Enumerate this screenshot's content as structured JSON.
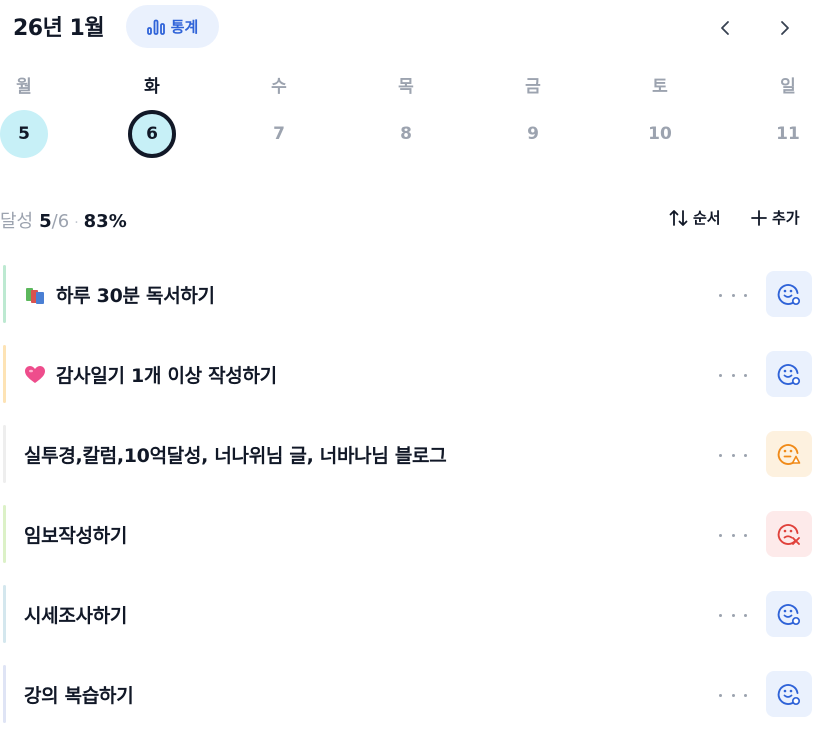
{
  "header": {
    "month_title": "26년 1월",
    "stats_label": "통계"
  },
  "week": {
    "weekdays": [
      "월",
      "화",
      "수",
      "목",
      "금",
      "토",
      "일"
    ],
    "days": [
      "5",
      "6",
      "7",
      "8",
      "9",
      "10",
      "11"
    ],
    "today_index": 1
  },
  "progress": {
    "label": "달성",
    "done": "5",
    "total": "/6",
    "separator": "·",
    "percent": "83%"
  },
  "toolbar": {
    "order_label": "순서",
    "add_label": "추가"
  },
  "habits": [
    {
      "title": "하루 30분 독서하기",
      "emoji": "books-icon",
      "bar_color": "#bde9d1",
      "status": "good",
      "status_bg": "#eaf1fd",
      "status_color": "#2f63d8"
    },
    {
      "title": "감사일기 1개 이상 작성하기",
      "emoji": "heart-icon",
      "bar_color": "#fde3b5",
      "status": "good",
      "status_bg": "#eaf1fd",
      "status_color": "#2f63d8"
    },
    {
      "title": "실투경,칼럼,10억달성, 너나위님 글, 너바나님 블로그",
      "emoji": "",
      "bar_color": "#eeeeee",
      "status": "warning",
      "status_bg": "#fdf1df",
      "status_color": "#f08a18"
    },
    {
      "title": "임보작성하기",
      "emoji": "",
      "bar_color": "#dcf1c7",
      "status": "fail",
      "status_bg": "#fdeaea",
      "status_color": "#e0413b"
    },
    {
      "title": "시세조사하기",
      "emoji": "",
      "bar_color": "#d4e7ee",
      "status": "good",
      "status_bg": "#eaf1fd",
      "status_color": "#2f63d8"
    },
    {
      "title": "강의 복습하기",
      "emoji": "",
      "bar_color": "#dfe4f5",
      "status": "good",
      "status_bg": "#eaf1fd",
      "status_color": "#2f63d8"
    }
  ]
}
